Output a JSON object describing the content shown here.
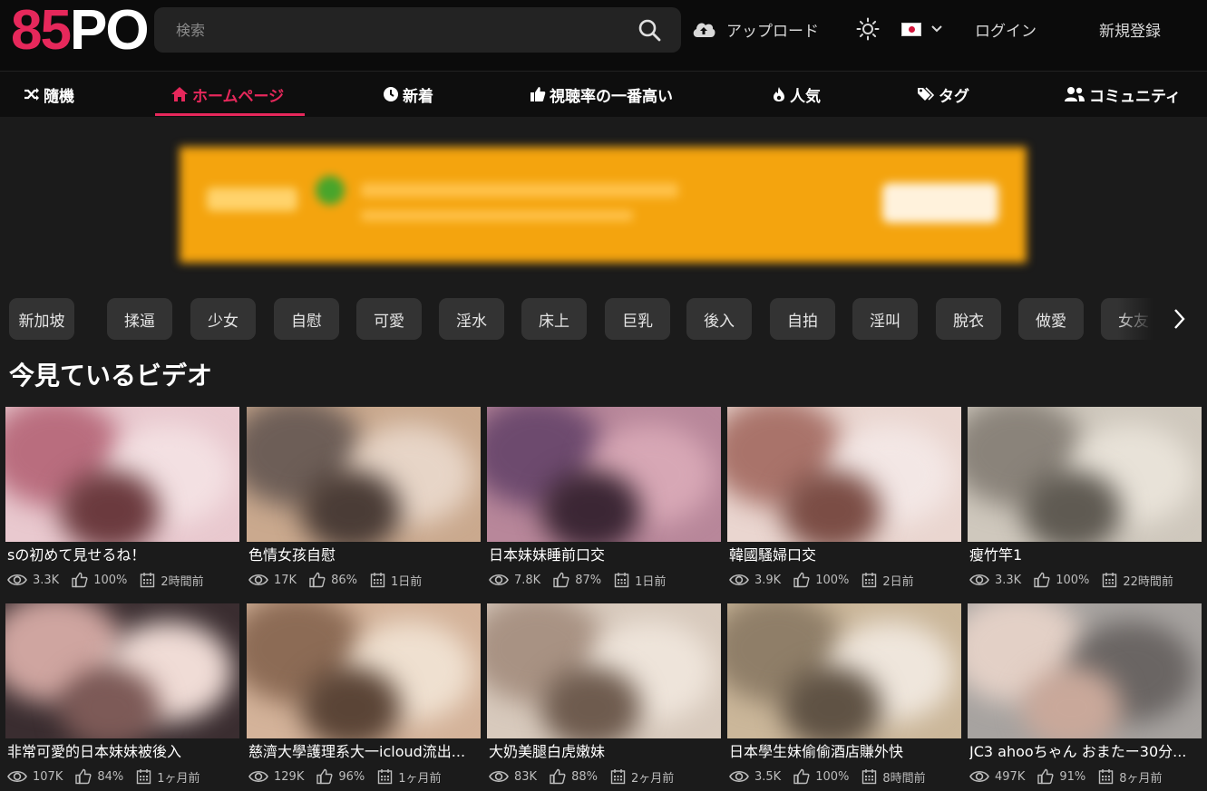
{
  "logo": {
    "text_a": "85",
    "text_b": "PO"
  },
  "header": {
    "search_placeholder": "検索",
    "upload_label": "アップロード",
    "login_label": "ログイン",
    "register_label": "新規登録"
  },
  "nav": {
    "items": [
      {
        "label": "隨機",
        "icon": "shuffle-icon"
      },
      {
        "label": "ホームページ",
        "icon": "home-icon",
        "active": true
      },
      {
        "label": "新着",
        "icon": "clock-icon"
      },
      {
        "label": "視聴率の一番高い",
        "icon": "thumbs-up-icon"
      },
      {
        "label": "人気",
        "icon": "fire-icon"
      },
      {
        "label": "タグ",
        "icon": "tags-icon"
      },
      {
        "label": "コミュニティ",
        "icon": "users-icon"
      }
    ]
  },
  "tags": [
    "新加坡",
    "揉逼",
    "少女",
    "自慰",
    "可愛",
    "淫水",
    "床上",
    "巨乳",
    "後入",
    "自拍",
    "淫叫",
    "脫衣",
    "做愛",
    "女友"
  ],
  "section_title": "今見ているビデオ",
  "colors": {
    "accent": "#e6285b",
    "background": "#1b1b1b",
    "header": "#0b0b0b",
    "tag_bg": "#333333"
  },
  "videos": [
    {
      "title": "sの初めて見せるね！",
      "views": "3.3K",
      "rating": "100%",
      "time": "2時間前"
    },
    {
      "title": "色情女孩自慰",
      "views": "17K",
      "rating": "86%",
      "time": "1日前"
    },
    {
      "title": "日本妹妹睡前口交",
      "views": "7.8K",
      "rating": "87%",
      "time": "1日前"
    },
    {
      "title": "韓國騷婦口交",
      "views": "3.9K",
      "rating": "100%",
      "time": "2日前"
    },
    {
      "title": "瘦竹竿1",
      "views": "3.3K",
      "rating": "100%",
      "time": "22時間前"
    },
    {
      "title": "非常可愛的日本妹妹被後入",
      "views": "107K",
      "rating": "84%",
      "time": "1ヶ月前"
    },
    {
      "title": "慈濟大學護理系大一icloud流出...",
      "views": "129K",
      "rating": "96%",
      "time": "1ヶ月前"
    },
    {
      "title": "大奶美腿白虎嫩妹",
      "views": "83K",
      "rating": "88%",
      "time": "2ヶ月前"
    },
    {
      "title": "日本學生妹偷偷酒店賺外快",
      "views": "3.5K",
      "rating": "100%",
      "time": "8時間前"
    },
    {
      "title": "JC3 ahooちゃん おまたー30分...",
      "views": "497K",
      "rating": "91%",
      "time": "8ヶ月前"
    }
  ]
}
